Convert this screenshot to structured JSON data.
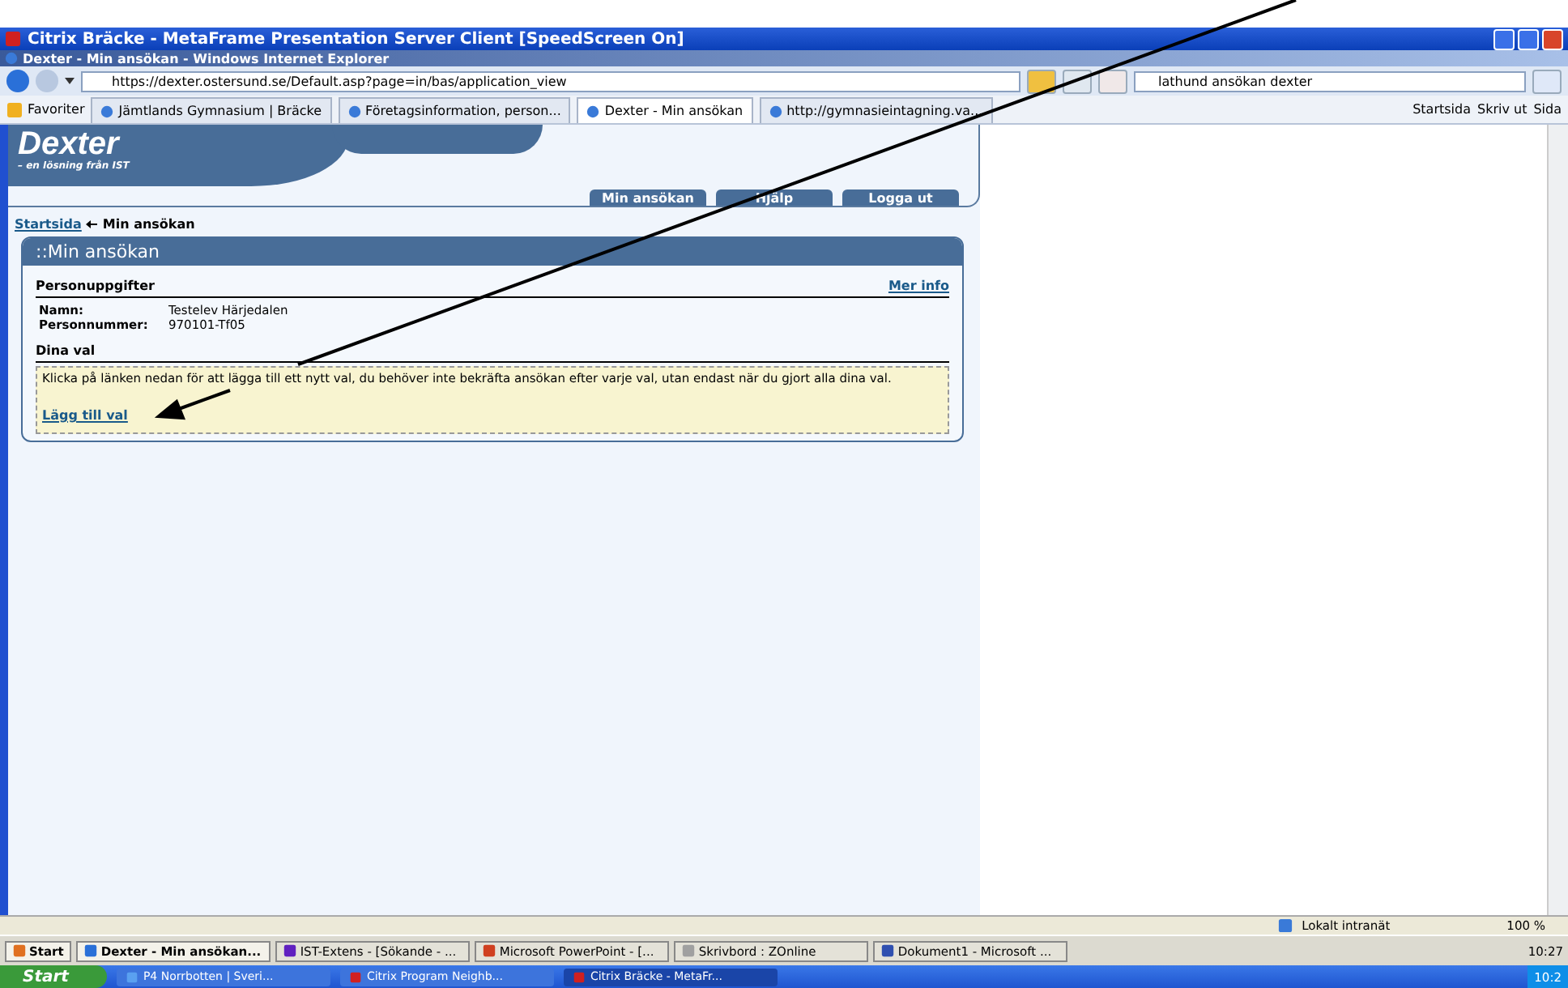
{
  "citrix_window": {
    "title": "Citrix Bräcke - MetaFrame Presentation Server Client [SpeedScreen On]"
  },
  "browser": {
    "title": "Dexter - Min ansökan - Windows Internet Explorer",
    "address": "https://dexter.ostersund.se/Default.asp?page=in/bas/application_view",
    "search": "lathund ansökan dexter",
    "favorites_label": "Favoriter",
    "tabs": [
      {
        "label": "Jämtlands Gymnasium | Bräcke",
        "selected": false
      },
      {
        "label": "Företagsinformation, person...",
        "selected": false
      },
      {
        "label": "Dexter - Min ansökan",
        "selected": true
      },
      {
        "label": "http://gymnasieintagning.va...",
        "selected": false
      }
    ],
    "commands": [
      "Startsida",
      "Skriv ut",
      "Sida"
    ]
  },
  "page": {
    "logo": "Dexter",
    "tagline": "– en lösning från IST",
    "nav": [
      "Min ansökan",
      "Hjälp",
      "Logga ut"
    ],
    "breadcrumb": {
      "link": "Startsida",
      "current": "Min ansökan"
    },
    "panel": {
      "title": "::Min ansökan",
      "section_1": "Personuppgifter",
      "more_link": "Mer info",
      "fields": [
        {
          "label": "Namn:",
          "value": "Testelev Härjedalen"
        },
        {
          "label": "Personnummer:",
          "value": "970101-Tf05"
        }
      ],
      "section_2": "Dina val",
      "notice": "Klicka på länken nedan för att lägga till ett nytt val, du behöver inte bekräfta ansökan efter varje val, utan endast när du gjort alla dina val.",
      "add_link": "Lägg till val"
    }
  },
  "status_bar": {
    "zone": "Lokalt intranät",
    "zoom": "100 %"
  },
  "inner_taskbar": {
    "start": "Start",
    "items": [
      {
        "label": "Dexter - Min ansökan...",
        "selected": true
      },
      {
        "label": "IST-Extens - [Sökande - ...",
        "selected": false
      },
      {
        "label": "Microsoft PowerPoint - [...",
        "selected": false
      },
      {
        "label": "Skrivbord : ZOnline",
        "selected": false
      },
      {
        "label": "Dokument1 - Microsoft ...",
        "selected": false
      }
    ],
    "clock": "10:27"
  },
  "outer_taskbar": {
    "start": "Start",
    "items": [
      {
        "label": "P4 Norrbotten | Sveri...",
        "selected": false
      },
      {
        "label": "Citrix Program Neighb...",
        "selected": false
      },
      {
        "label": "Citrix Bräcke - MetaFr...",
        "selected": true
      }
    ],
    "clock": "10:2"
  }
}
